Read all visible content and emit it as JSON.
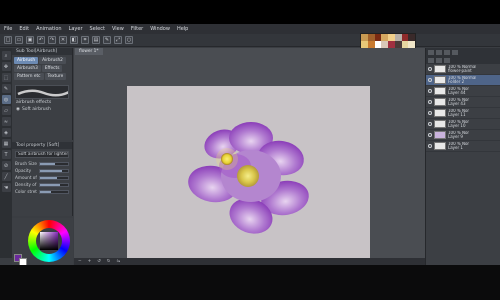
{
  "menubar": {
    "items": [
      "File",
      "Edit",
      "Animation",
      "Layer",
      "Select",
      "View",
      "Filter",
      "Window",
      "Help"
    ]
  },
  "toolbar": {
    "icons": [
      "new-file-icon",
      "open-icon",
      "save-icon",
      "undo-icon",
      "redo-icon",
      "clear-icon",
      "fill-icon",
      "snap-icon",
      "ruler-icon",
      "pen-icon",
      "transform-icon",
      "circle-icon"
    ]
  },
  "swatches": [
    "#c89a52",
    "#a0602a",
    "#7a2a12",
    "#d5a860",
    "#f2d08a",
    "#b8b0a8",
    "#8e2a2a",
    "#3a2a2a",
    "#e8c878",
    "#c87a30",
    "#ffffff",
    "#d8c8b8",
    "#a03040",
    "#4a3a38",
    "#e6d6a0",
    "#f0e6c8",
    "#d05050",
    "#903838",
    "#ffffff",
    "#7a7a7a",
    "#c0404c",
    "#e8d0d0",
    "#6a4a4a",
    "#f8e8b0"
  ],
  "subtool": {
    "header": "Sub Tool[Airbrush]",
    "tabs": [
      "Airbrush",
      "Airbrush2",
      "Airbrush3",
      "Effects",
      "Pattern etc",
      "Texture"
    ],
    "brush_name": "airbrush effects",
    "items": [
      {
        "label": "Soft airbrush"
      }
    ]
  },
  "props": {
    "header": "Tool property [Soft]",
    "name": "Soft airbrush for lightening",
    "rows": [
      {
        "label": "Brush Size",
        "value": 0.55
      },
      {
        "label": "Opacity",
        "value": 0.8
      },
      {
        "label": "Amount of paint",
        "value": 0.6
      },
      {
        "label": "Density of paint",
        "value": 0.7
      },
      {
        "label": "Color stretch",
        "value": 0.4
      }
    ]
  },
  "canvas": {
    "tab": "flower 1*"
  },
  "layers": [
    {
      "name": "100 % Normal\nflower-paint",
      "sel": false
    },
    {
      "name": "100 % Normal\nFolder 2",
      "sel": true
    },
    {
      "name": "100 % Nor\nLayer 44",
      "sel": false
    },
    {
      "name": "100 % Nor\nLayer 43",
      "sel": false
    },
    {
      "name": "100 % Nor\nLayer 11",
      "sel": false
    },
    {
      "name": "100 % Nor\nLayer 10",
      "sel": false
    },
    {
      "name": "100 % Nor\nLayer 9",
      "sel": false
    },
    {
      "name": "100 % Nor\nLayer 1",
      "sel": false
    }
  ]
}
